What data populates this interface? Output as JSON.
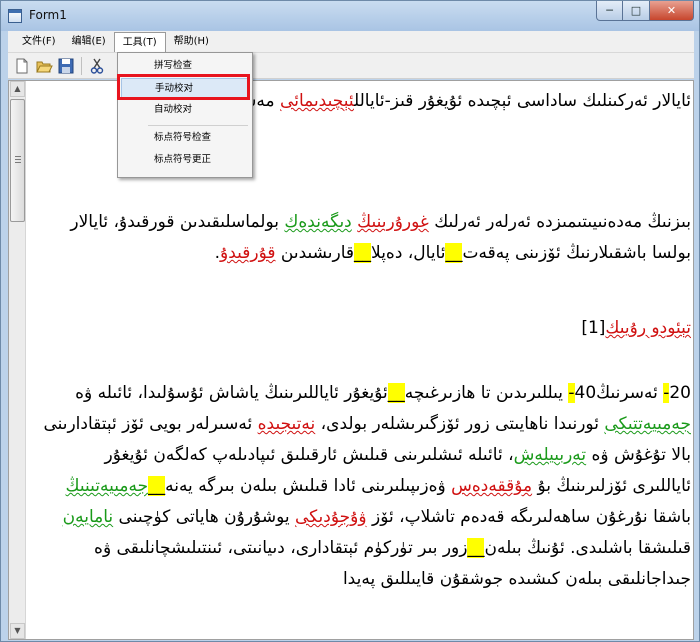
{
  "window": {
    "title": "Form1",
    "minimize": "─",
    "maximize": "□",
    "close": "✕"
  },
  "menu": {
    "file": "文件(F)",
    "edit": "编辑(E)",
    "tools": "工具(T)",
    "help": "帮助(H)"
  },
  "toolbar": {
    "icons": [
      "new-document-icon",
      "open-folder-icon",
      "save-disk-icon",
      "cut-scissors-icon"
    ]
  },
  "tools_menu": {
    "items": [
      "拼写检查",
      "手动校对",
      "自动校对",
      "标点符号检查",
      "标点符号更正"
    ],
    "selected_index": 1
  },
  "editor": {
    "p1": {
      "t1": "ئايالار ئەركىنلىك ساداسى ئېچىدە ئۇيغۇر قىز-ئايالل",
      "t2": "ئېچىدىمائى",
      "t3": " مەسىلەر"
    },
    "p2": {
      "t1": "بىزنىڭ مەدەنىيىتىمىزدە ئەرلەر ئەرلىك ",
      "e1": "غورۇرىنىڭ",
      "t2": " ",
      "e2": "دىگەندەك",
      "t3": " بولماسلىقىدىن قورقىدۇ، ئايالار بولسا باشقىلارنىڭ ئۆزىنى پەقەت",
      "h1": "__",
      "t4": "ئايال، دەپلا",
      "h2": "__",
      "t5": "قارىشىدىن ",
      "e3": "قۇرقىدۇ",
      "t6": "."
    },
    "p3": {
      "e1": "تېئودو رۇيىك",
      "t1": "[1]"
    },
    "p4": {
      "t1": "20",
      "h1": "-",
      "t2": " ئەسرنىڭ40",
      "h2": "-",
      "t3": " يىللىرىدىن تا ھازىرغىچە",
      "h3": "__",
      "t4": "ئۇيغۇر ئاياللىرىنىڭ ياشاش ئۇسۇلىدا، ئائىلە ۋە ",
      "e1": "جەمىيەتتىكى",
      "t5": " ئورنىدا ناھايىتى زور ئۆزگىرىشلەر بولدى، ",
      "e2": "نەتىجىدە",
      "t6": " ئەسىرلەر بويى ئۆز ئېتقادارىنى بالا تۇغۇش ۋە ",
      "e3": "تەربىيلەش",
      "t7": "، ئائىلە ئىشلىرىنى قىلىش ئارقىلىق ئىپادىلەپ كەلگەن ئۇيغۇر ئاياللىرى ئۆزلىرىنىڭ بۇ ",
      "e4": "مۇققەدەس",
      "t8": " ۋەزىپىلىرىنى ئادا قىلىش بىلەن بىرگە يەنە",
      "h4": "__",
      "e5": "جەمىيەتىنىڭ",
      "t9": " باشقا نۇرغۇن ساھەلىرىگە قەدەم تاشلاپ، ئۆز ",
      "e6": "ۋۇجۇدىكى",
      "t10": " يوشۇرۇن ھاياتى كۈچىنى ",
      "e7": "نامايەن",
      "t11": " قىلىشقا باشلىدى. ئۇنىڭ بىلەن",
      "h5": "__",
      "t12": "زور بىر تۈركۈم ئېتقادارى، دىيانىتى، ئىنتىلىشچانلىقى ۋە جىداجانلىقى بىلەن كىشىدە جوشقۇن قايىللىق پەيدا"
    }
  }
}
